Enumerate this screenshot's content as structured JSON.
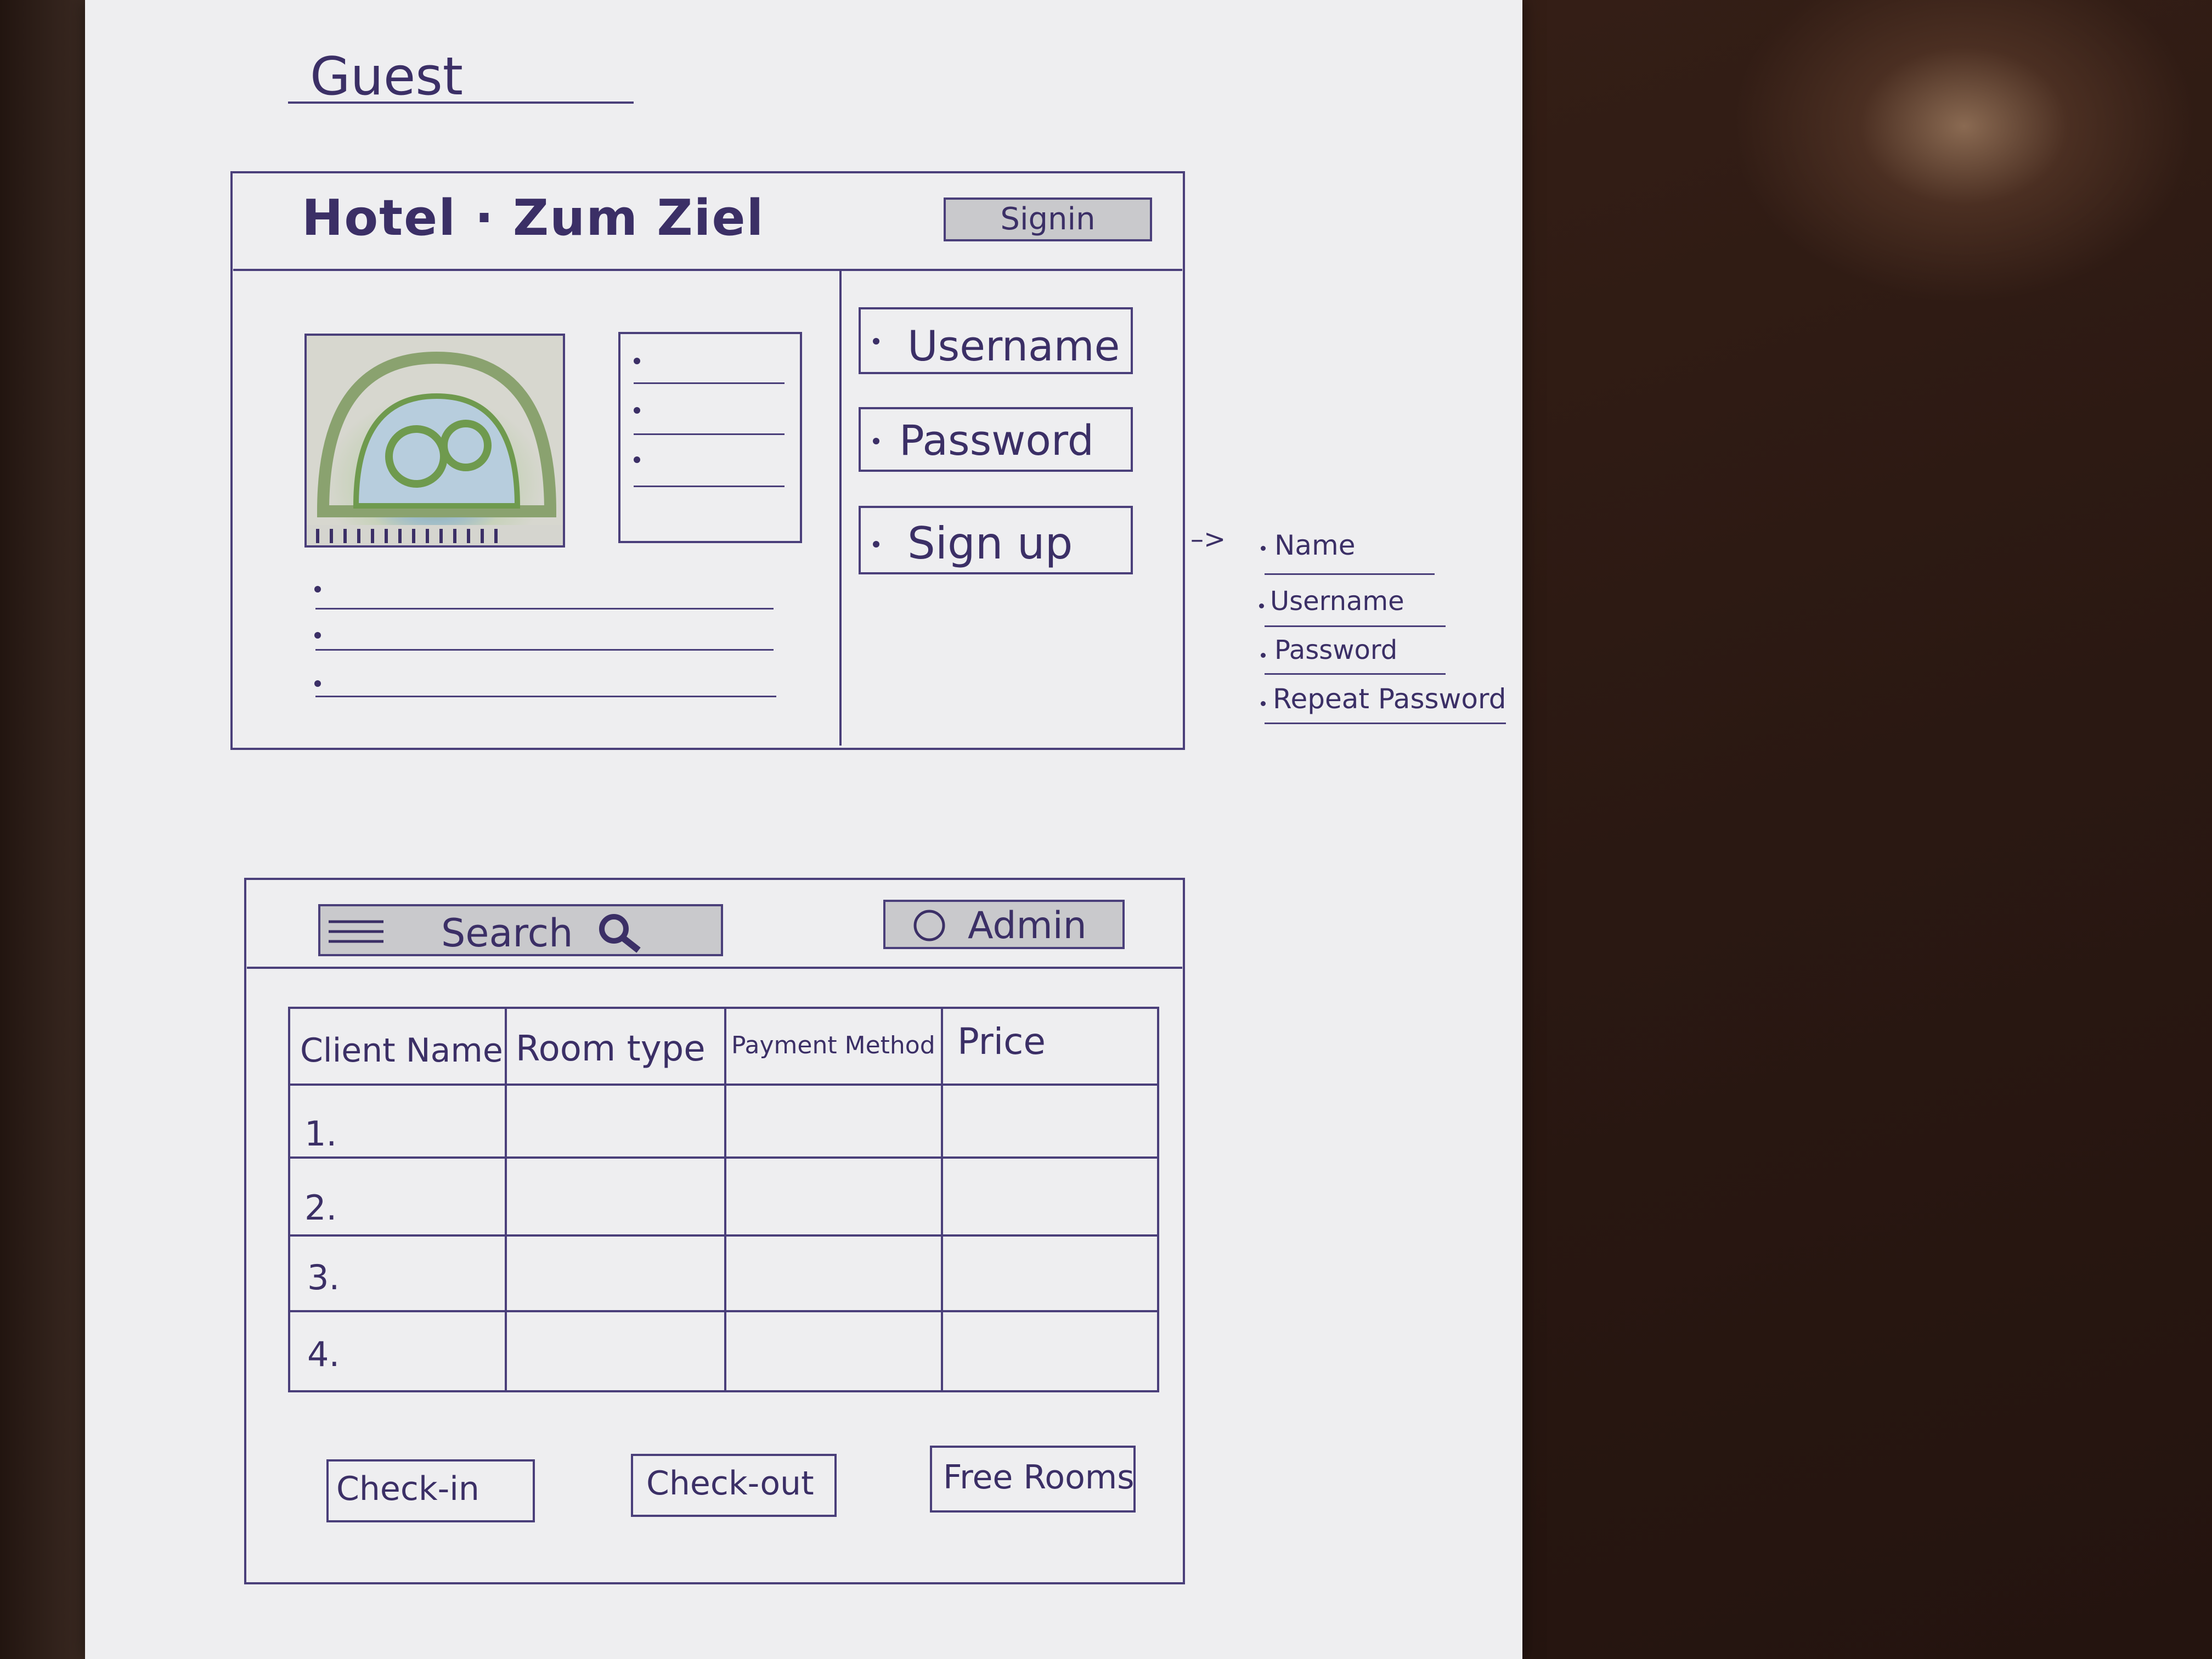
{
  "page_label": "Guest",
  "login_screen": {
    "hotel_name": "Hotel · Zum Ziel",
    "signin_button": "Signin",
    "fields": [
      "Username",
      "Password"
    ],
    "signup_button": "Sign up",
    "arrow": "–>",
    "signup_fields": [
      "Name",
      "Username",
      "Password",
      "Repeat Password"
    ]
  },
  "admin_screen": {
    "search_label": "Search",
    "admin_button": "Admin",
    "table": {
      "headers": [
        "Client Name",
        "Room type",
        "Payment Method",
        "Price"
      ],
      "row_numbers": [
        "1.",
        "2.",
        "3.",
        "4."
      ]
    },
    "buttons": [
      "Check-in",
      "Check-out",
      "Free Rooms"
    ]
  },
  "colors": {
    "ink": "#3b2f66",
    "paper": "#eeeef0",
    "desk": "#2a1812",
    "button_fill": "#c9c9cc"
  },
  "icons": [
    "image-placeholder-icon",
    "menu-icon",
    "search-icon",
    "radio-icon"
  ]
}
